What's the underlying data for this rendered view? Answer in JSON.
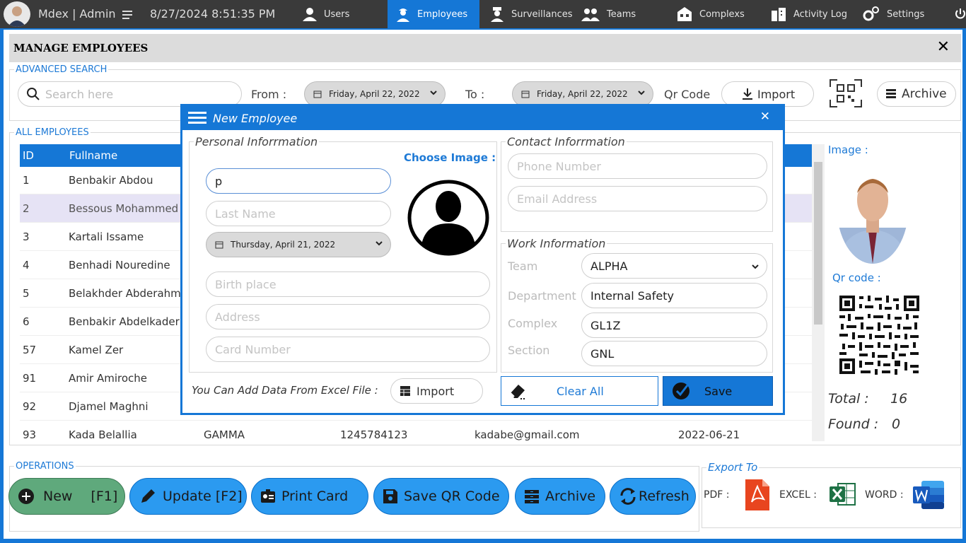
{
  "topbar": {
    "app_title": "Mdex | Admin",
    "datetime": "8/27/2024 8:51:35 PM",
    "nav": [
      {
        "label": "Users",
        "icon": "user-icon"
      },
      {
        "label": "Employees",
        "icon": "employee-icon",
        "active": true
      },
      {
        "label": "Surveillances",
        "icon": "guard-icon"
      },
      {
        "label": "Teams",
        "icon": "team-icon"
      },
      {
        "label": "Complexs",
        "icon": "building-icon"
      },
      {
        "label": "Activity Log",
        "icon": "city-icon"
      },
      {
        "label": "Settings",
        "icon": "gear-icon"
      }
    ]
  },
  "page": {
    "title": "MANAGE EMPLOYEES"
  },
  "search": {
    "legend": "ADVANCED SEARCH",
    "placeholder": "Search here",
    "from_label": "From :",
    "from_date": "Friday, April 22, 2022",
    "to_label": "To :",
    "to_date": "Friday, April 22, 2022",
    "qr_label": "Qr Code",
    "import_label": "Import",
    "archive_label": "Archive"
  },
  "table": {
    "legend": "ALL EMPLOYEES",
    "headers": [
      "ID",
      "Fullname"
    ],
    "rows": [
      {
        "id": "1",
        "name": "Benbakir Abdou"
      },
      {
        "id": "2",
        "name": "Bessous Mohammed"
      },
      {
        "id": "3",
        "name": "Kartali Issame"
      },
      {
        "id": "4",
        "name": "Benhadi Nouredine"
      },
      {
        "id": "5",
        "name": "Belakhder Abderahm"
      },
      {
        "id": "6",
        "name": "Benbakir Abdelkader"
      },
      {
        "id": "57",
        "name": "Kamel Zer"
      },
      {
        "id": "91",
        "name": "Amir Amiroche"
      },
      {
        "id": "92",
        "name": "Djamel Maghni"
      },
      {
        "id": "93",
        "name": "Kada Belallia",
        "team": "GAMMA",
        "phone": "1245784123",
        "email": "kadabe@gmail.com",
        "date": "2022-06-21"
      }
    ]
  },
  "side": {
    "image_label": "Image :",
    "qr_label": "Qr code :",
    "total_label": "Total :",
    "total_value": "16",
    "found_label": "Found :",
    "found_value": "0"
  },
  "operations": {
    "legend": "OPERATIONS",
    "new": "New",
    "new_key": "[F1]",
    "update": "Update [F2]",
    "print": "Print Card",
    "saveqr": "Save QR Code",
    "archive": "Archive",
    "refresh": "Refresh"
  },
  "export": {
    "legend": "Export To",
    "pdf": "PDF :",
    "excel": "EXCEL :",
    "word": "WORD :"
  },
  "dialog": {
    "title": "New Employee",
    "personal_legend": "Personal Inforrmation",
    "choose_image": "Choose Image :",
    "first_name_value": "p",
    "last_name_placeholder": "Last Name",
    "birth_date": "Thursday, April 21, 2022",
    "birth_place_placeholder": "Birth place",
    "address_placeholder": "Address",
    "card_placeholder": "Card Number",
    "contact_legend": "Contact Inforrmation",
    "phone_placeholder": "Phone Number",
    "email_placeholder": "Email Address",
    "work_legend": "Work Information",
    "team_label": "Team",
    "team_value": "ALPHA",
    "department_label": "Department",
    "department_value": "Internal Safety",
    "complex_label": "Complex",
    "complex_value": "GL1Z",
    "section_label": "Section",
    "section_value": "GNL",
    "excel_hint": "You Can Add Data From Excel File :",
    "import_label": "Import",
    "clear_label": "Clear All",
    "save_label": "Save"
  }
}
